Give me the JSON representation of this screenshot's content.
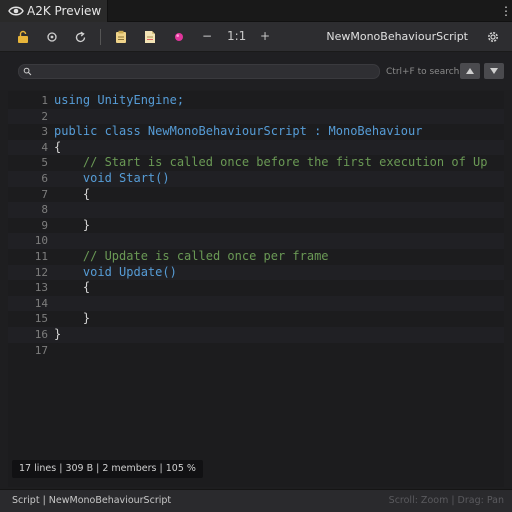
{
  "window": {
    "tab_title": "A2K Preview",
    "menu_icon": "kebab-menu-icon"
  },
  "toolbar": {
    "icons": [
      "lock-icon",
      "record-icon",
      "refresh-icon",
      "clipboard-icon",
      "document-icon",
      "color-orb-icon",
      "settings-icon"
    ],
    "zoom_out_label": "−",
    "zoom_reset_label": "1:1",
    "zoom_in_label": "+",
    "filename": "NewMonoBehaviourScript"
  },
  "search": {
    "value": "",
    "placeholder": "",
    "hint": "Ctrl+F to search",
    "prev_icon": "arrow-up-icon",
    "next_icon": "arrow-down-icon"
  },
  "code": {
    "lines": [
      {
        "n": "1",
        "tokens": [
          {
            "t": "using UnityEngine;",
            "c": "#569cd6"
          }
        ]
      },
      {
        "n": "2",
        "tokens": []
      },
      {
        "n": "3",
        "tokens": [
          {
            "t": "public class NewMonoBehaviourScript : MonoBehaviour",
            "c": "#569cd6"
          }
        ]
      },
      {
        "n": "4",
        "tokens": [
          {
            "t": "{",
            "c": "#d4d4d4"
          }
        ]
      },
      {
        "n": "5",
        "tokens": [
          {
            "t": "    // Start is called once before the first execution of Up",
            "c": "#6a9955"
          }
        ]
      },
      {
        "n": "6",
        "tokens": [
          {
            "t": "    void Start()",
            "c": "#569cd6"
          }
        ]
      },
      {
        "n": "7",
        "tokens": [
          {
            "t": "    {",
            "c": "#d4d4d4"
          }
        ]
      },
      {
        "n": "8",
        "tokens": []
      },
      {
        "n": "9",
        "tokens": [
          {
            "t": "    }",
            "c": "#d4d4d4"
          }
        ]
      },
      {
        "n": "10",
        "tokens": []
      },
      {
        "n": "11",
        "tokens": [
          {
            "t": "    // Update is called once per frame",
            "c": "#6a9955"
          }
        ]
      },
      {
        "n": "12",
        "tokens": [
          {
            "t": "    void Update()",
            "c": "#569cd6"
          }
        ]
      },
      {
        "n": "13",
        "tokens": [
          {
            "t": "    {",
            "c": "#d4d4d4"
          }
        ]
      },
      {
        "n": "14",
        "tokens": []
      },
      {
        "n": "15",
        "tokens": [
          {
            "t": "    }",
            "c": "#d4d4d4"
          }
        ]
      },
      {
        "n": "16",
        "tokens": [
          {
            "t": "}",
            "c": "#d4d4d4"
          }
        ]
      },
      {
        "n": "17",
        "tokens": []
      }
    ]
  },
  "stats": {
    "text": "17 lines | 309 B | 2 members | 105 %"
  },
  "status": {
    "left": "Script | NewMonoBehaviourScript",
    "right": "Scroll: Zoom | Drag: Pan"
  },
  "colors": {
    "background": "#1e1e20",
    "keyword": "#569cd6",
    "comment": "#6a9955",
    "plain": "#d4d4d4",
    "line_number": "#7d7d7d"
  }
}
